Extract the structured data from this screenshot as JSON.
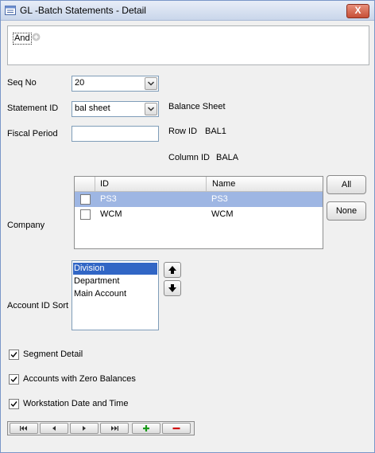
{
  "window": {
    "title": "GL -Batch Statements - Detail",
    "close_label": "X"
  },
  "filter": {
    "operator": "And"
  },
  "form": {
    "seq_no": {
      "label": "Seq No",
      "value": "20"
    },
    "statement_id": {
      "label": "Statement ID",
      "value": "bal sheet",
      "description": "Balance Sheet"
    },
    "fiscal_period": {
      "label": "Fiscal Period",
      "value": ""
    },
    "row_id": {
      "label": "Row ID",
      "value": "BAL1"
    },
    "column_id": {
      "label": "Column ID",
      "value": "BALA"
    }
  },
  "company": {
    "label": "Company",
    "columns": [
      "ID",
      "Name"
    ],
    "rows": [
      {
        "id": "PS3",
        "name": "PS3",
        "selected": true,
        "checked": false
      },
      {
        "id": "WCM",
        "name": "WCM",
        "selected": false,
        "checked": false
      }
    ],
    "all_label": "All",
    "none_label": "None"
  },
  "account_sort": {
    "label": "Account ID Sort",
    "items": [
      "Division",
      "Department",
      "Main Account"
    ],
    "selected": "Division"
  },
  "options": {
    "segment_detail": {
      "label": "Segment Detail",
      "checked": true
    },
    "zero_balances": {
      "label": "Accounts with Zero Balances",
      "checked": true
    },
    "workstation_datetime": {
      "label": "Workstation Date and Time",
      "checked": true
    }
  },
  "colors": {
    "selection": "#9eb6e3",
    "list_selection": "#3166c5",
    "add": "#1a9a1a",
    "remove": "#d01010"
  },
  "nav_icons": [
    "first-record-icon",
    "prev-record-icon",
    "next-record-icon",
    "last-record-icon",
    "add-record-icon",
    "delete-record-icon"
  ]
}
